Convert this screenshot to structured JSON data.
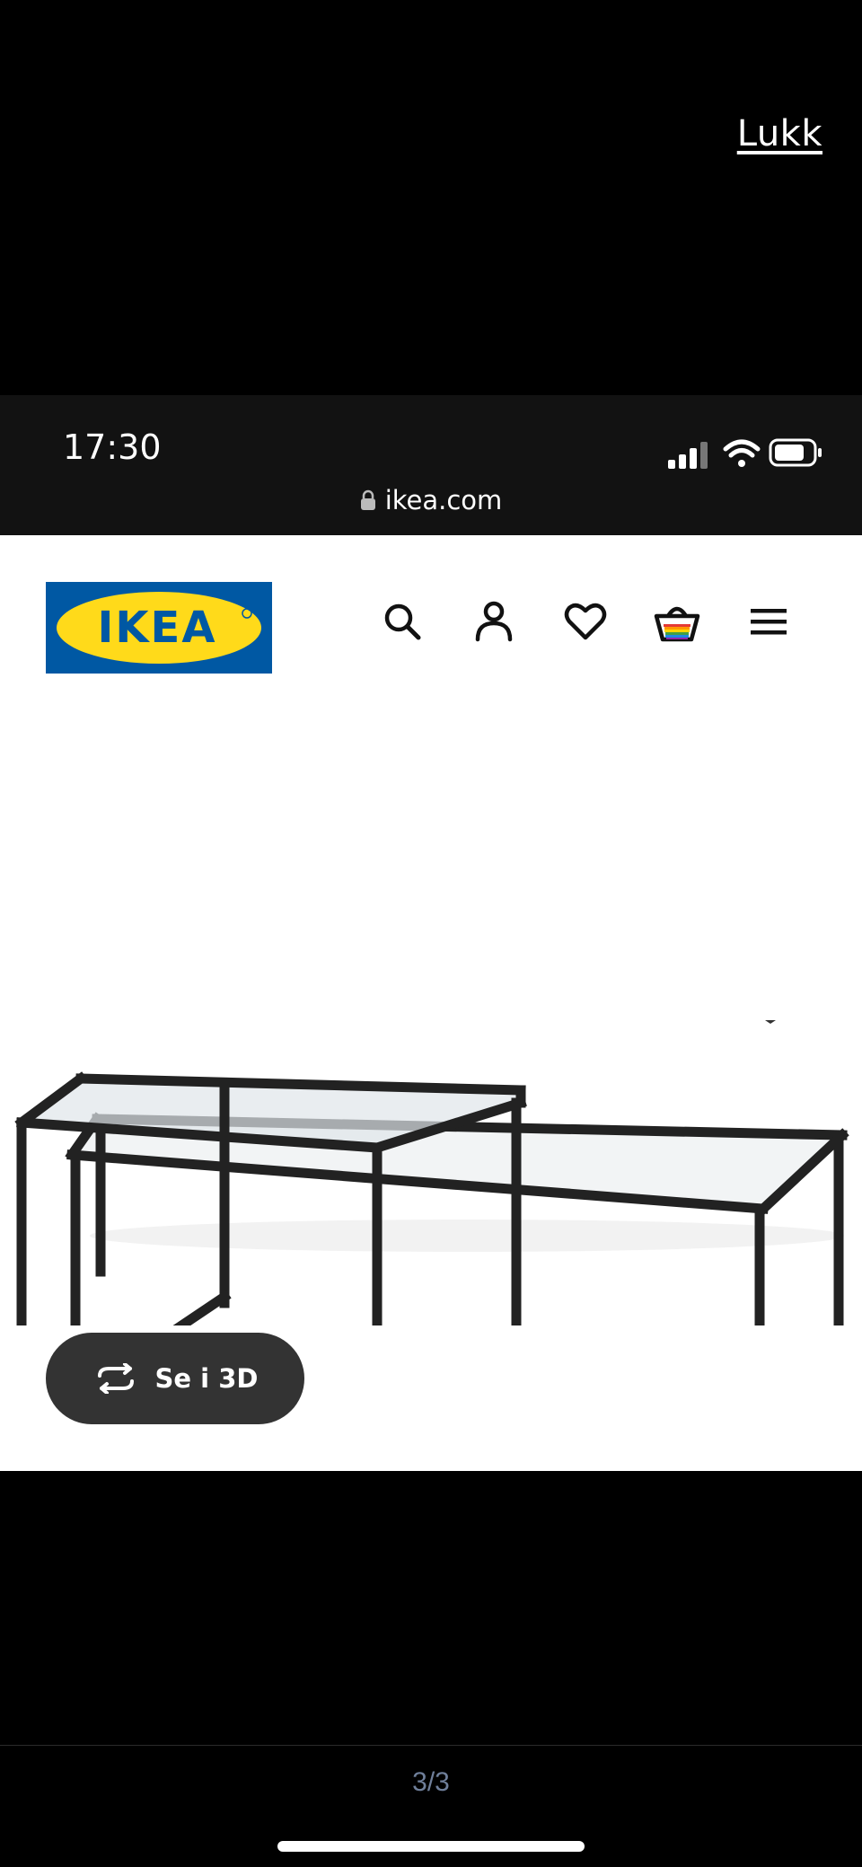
{
  "viewer": {
    "close_label": "Lukk",
    "counter": "3/3"
  },
  "status_bar": {
    "time": "17:30",
    "url": "ikea.com"
  },
  "site": {
    "logo_text": "IKEA",
    "nav_icons": [
      "search-icon",
      "user-icon",
      "heart-icon",
      "basket-icon",
      "menu-icon"
    ]
  },
  "product": {
    "view_3d_label": "Se i 3D"
  },
  "colors": {
    "ikea_blue": "#0058A3",
    "ikea_yellow": "#FFDA1A",
    "pill_bg": "#333333"
  }
}
